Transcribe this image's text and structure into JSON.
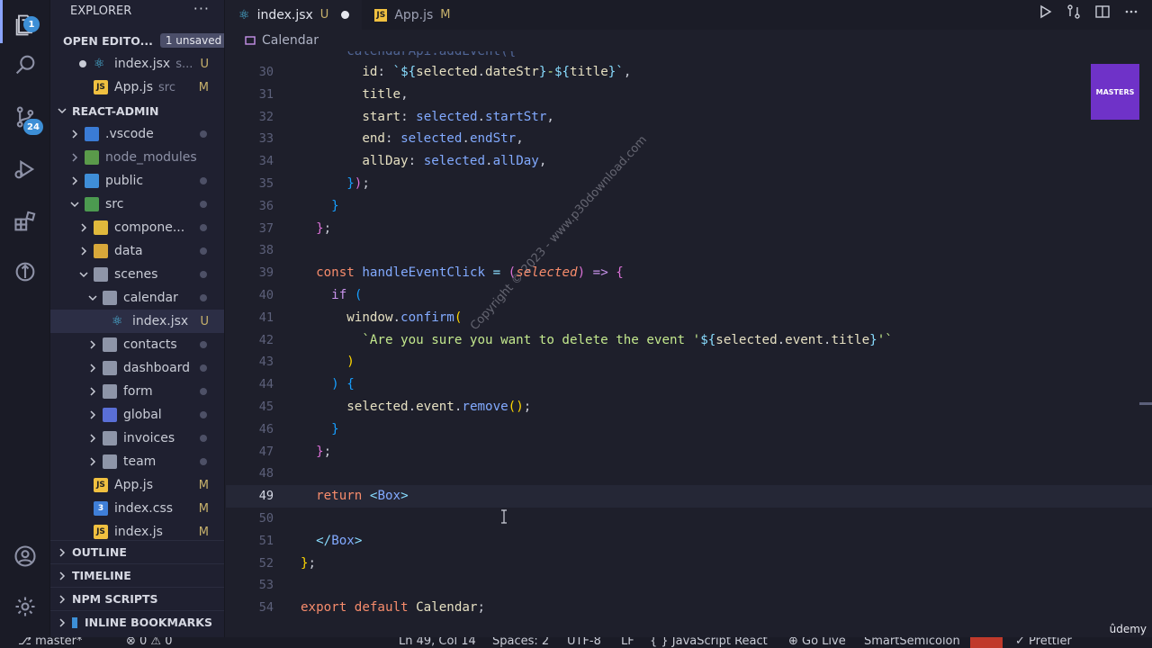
{
  "activity_bar": {
    "explorer_badge": "1",
    "scm_badge": "24"
  },
  "sidebar": {
    "title": "EXPLORER",
    "open_editors_label": "OPEN EDITO...",
    "unsaved_label": "1 unsaved",
    "open_editors": [
      {
        "name": "index.jsx",
        "detail": "s...",
        "status": "U"
      },
      {
        "name": "App.js",
        "detail": "src",
        "status": "M"
      }
    ],
    "project_label": "REACT-ADMIN",
    "tree": [
      {
        "name": ".vscode",
        "status": ""
      },
      {
        "name": "node_modules",
        "status": ""
      },
      {
        "name": "public",
        "status": ""
      },
      {
        "name": "src",
        "status": ""
      },
      {
        "name": "compone...",
        "status": ""
      },
      {
        "name": "data",
        "status": ""
      },
      {
        "name": "scenes",
        "status": ""
      },
      {
        "name": "calendar",
        "status": ""
      },
      {
        "name": "index.jsx",
        "status": "U"
      },
      {
        "name": "contacts",
        "status": ""
      },
      {
        "name": "dashboard",
        "status": ""
      },
      {
        "name": "form",
        "status": ""
      },
      {
        "name": "global",
        "status": ""
      },
      {
        "name": "invoices",
        "status": ""
      },
      {
        "name": "team",
        "status": ""
      },
      {
        "name": "App.js",
        "status": "M"
      },
      {
        "name": "index.css",
        "status": "M"
      },
      {
        "name": "index.js",
        "status": "M"
      }
    ],
    "outline_label": "OUTLINE",
    "timeline_label": "TIMELINE",
    "npm_label": "NPM SCRIPTS",
    "bookmarks_label": "INLINE BOOKMARKS"
  },
  "tabs": [
    {
      "name": "index.jsx",
      "status": "U"
    },
    {
      "name": "App.js",
      "status": "M"
    }
  ],
  "breadcrumb": "Calendar",
  "editor": {
    "line_numbers": [
      "30",
      "31",
      "32",
      "33",
      "34",
      "35",
      "36",
      "37",
      "38",
      "39",
      "40",
      "41",
      "42",
      "43",
      "44",
      "45",
      "46",
      "47",
      "48",
      "49",
      "50",
      "51",
      "52",
      "53",
      "54"
    ],
    "current_line": "49"
  },
  "overlay": {
    "masters_logo": "MASTERS",
    "watermark": "Copyright © 2023 - www.p30download.com",
    "udemy": "ûdemy"
  },
  "statusbar": {
    "branch": "master*",
    "errors": "⊗ 0 ⚠ 0",
    "position": "Ln 49, Col 14",
    "spaces": "Spaces: 2",
    "encoding": "UTF-8",
    "eol": "LF",
    "language": "{ } JavaScript React",
    "golive": "⊕ Go Live",
    "smartsemicolon": "SmartSemicolon",
    "prettier": "✓ Prettier"
  },
  "colors": {
    "background": "#1e1f2b",
    "sidebar": "#1f2030",
    "accent": "#3d8fd6",
    "git_status": "#c8b26c"
  }
}
